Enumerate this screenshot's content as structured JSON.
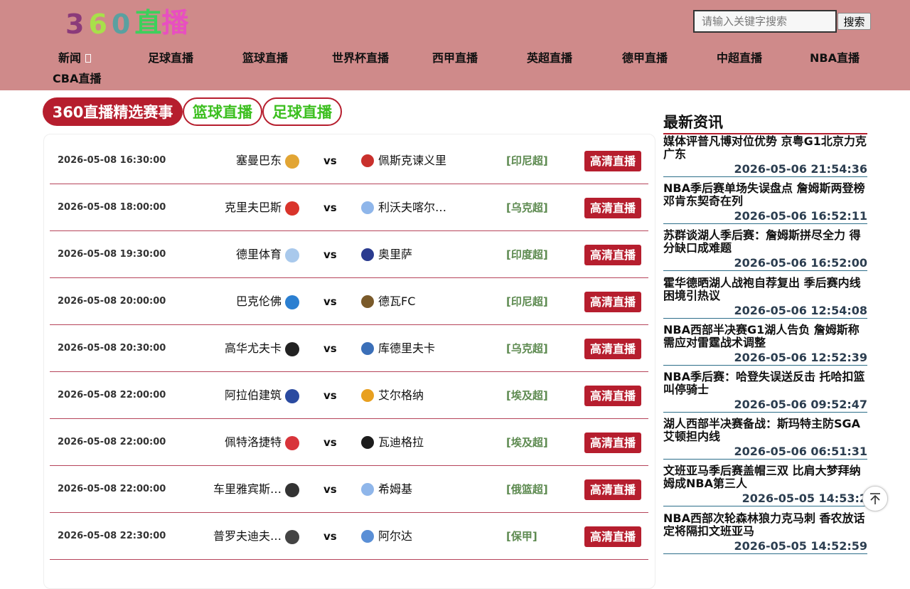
{
  "logo": {
    "chars": [
      "3",
      "6",
      "0",
      "直",
      "播"
    ],
    "colors": [
      "#8b3a7a",
      "#a8e04a",
      "#5aa0a0",
      "#3ecf5c",
      "#e84fc0"
    ]
  },
  "search": {
    "placeholder": "请输入关键字搜索",
    "button_label": "搜索"
  },
  "nav": {
    "items": [
      "新闻",
      "足球直播",
      "篮球直播",
      "世界杯直播",
      "西甲直播",
      "英超直播",
      "德甲直播",
      "中超直播",
      "NBA直播",
      "CBA直播"
    ]
  },
  "tabs": [
    "360直播精选赛事",
    "篮球直播",
    "足球直播"
  ],
  "matches": [
    {
      "time": "2026-05-08 16:30:00",
      "home": "塞曼巴东",
      "away": "佩斯克谏义里",
      "league": "[印尼超]",
      "button": "高清直播",
      "home_icon_color": "#e2a534",
      "away_icon_color": "#c9302c"
    },
    {
      "time": "2026-05-08 18:00:00",
      "home": "克里夫巴斯",
      "away": "利沃夫喀尔…",
      "league": "[乌克超]",
      "button": "高清直播",
      "home_icon_color": "#d9342b",
      "away_icon_color": "#8fb6ea"
    },
    {
      "time": "2026-05-08 19:30:00",
      "home": "德里体育",
      "away": "奥里萨",
      "league": "[印度超]",
      "button": "高清直播",
      "home_icon_color": "#a9c9ec",
      "away_icon_color": "#2a3b8f"
    },
    {
      "time": "2026-05-08 20:00:00",
      "home": "巴克伦佛",
      "away": "德瓦FC",
      "league": "[印尼超]",
      "button": "高清直播",
      "home_icon_color": "#2b7fd1",
      "away_icon_color": "#7a5a2a"
    },
    {
      "time": "2026-05-08 20:30:00",
      "home": "高华尤夫卡",
      "away": "库德里夫卡",
      "league": "[乌克超]",
      "button": "高清直播",
      "home_icon_color": "#222222",
      "away_icon_color": "#3b6fb8"
    },
    {
      "time": "2026-05-08 22:00:00",
      "home": "阿拉伯建筑",
      "away": "艾尔格纳",
      "league": "[埃及超]",
      "button": "高清直播",
      "home_icon_color": "#2a4aa0",
      "away_icon_color": "#e8a020"
    },
    {
      "time": "2026-05-08 22:00:00",
      "home": "佩特洛捷特",
      "away": "瓦迪格拉",
      "league": "[埃及超]",
      "button": "高清直播",
      "home_icon_color": "#d8343a",
      "away_icon_color": "#1c1c1c"
    },
    {
      "time": "2026-05-08 22:00:00",
      "home": "车里雅宾斯…",
      "away": "希姆基",
      "league": "[俄篮超]",
      "button": "高清直播",
      "home_icon_color": "#333333",
      "away_icon_color": "#8fb6ea"
    },
    {
      "time": "2026-05-08 22:30:00",
      "home": "普罗夫迪夫…",
      "away": "阿尔达",
      "league": "[保甲]",
      "button": "高清直播",
      "home_icon_color": "#444444",
      "away_icon_color": "#5a8fd6"
    }
  ],
  "news": {
    "title": "最新资讯",
    "items": [
      {
        "text": "媒体评普凡博对位优势 京粤G1北京力克广东",
        "date": "2026-05-06 21:54:36"
      },
      {
        "text": "NBA季后赛单场失误盘点 詹姆斯两登榜邓肯东契奇在列",
        "date": "2026-05-06 16:52:11"
      },
      {
        "text": "苏群谈湖人季后赛：詹姆斯拼尽全力 得分缺口成难题",
        "date": "2026-05-06 16:52:00"
      },
      {
        "text": "霍华德晒湖人战袍自荐复出 季后赛内线困境引热议",
        "date": "2026-05-06 12:54:08"
      },
      {
        "text": "NBA西部半决赛G1湖人告负 詹姆斯称需应对雷霆战术调整",
        "date": "2026-05-06 12:52:39"
      },
      {
        "text": "NBA季后赛：哈登失误送反击 托哈扣篮叫停骑士",
        "date": "2026-05-06 09:52:47"
      },
      {
        "text": "湖人西部半决赛备战：斯玛特主防SGA 艾顿担内线",
        "date": "2026-05-06 06:51:31"
      },
      {
        "text": "文班亚马季后赛盖帽三双 比肩大梦拜纳姆成NBA第三人",
        "date": "2026-05-05 14:53:2"
      },
      {
        "text": "NBA西部次轮森林狼力克马刺 香农放话定将隔扣文班亚马",
        "date": "2026-05-05 14:52:59"
      }
    ]
  }
}
